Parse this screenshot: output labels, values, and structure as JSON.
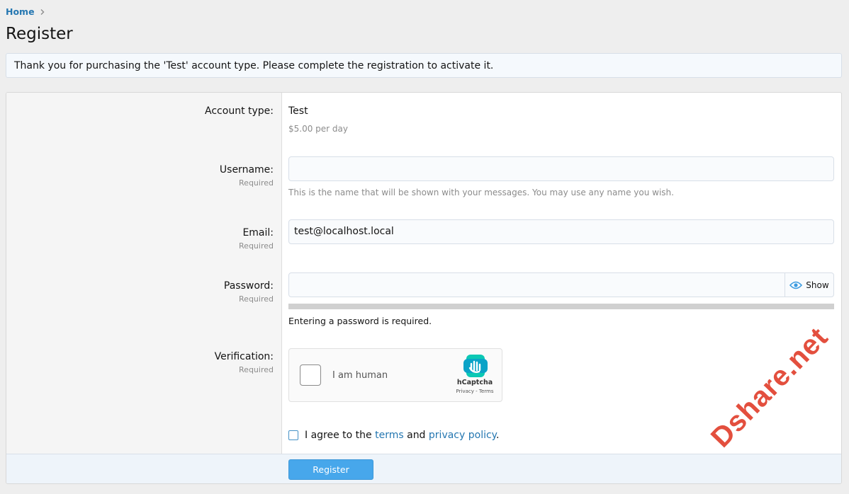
{
  "breadcrumb": {
    "home": "Home"
  },
  "page": {
    "title": "Register"
  },
  "notice": "Thank you for purchasing the 'Test' account type. Please complete the registration to activate it.",
  "form": {
    "account_type": {
      "label": "Account type:",
      "name": "Test",
      "cost": "$5.00 per day"
    },
    "username": {
      "label": "Username:",
      "required": "Required",
      "value": "",
      "hint": "This is the name that will be shown with your messages. You may use any name you wish."
    },
    "email": {
      "label": "Email:",
      "required": "Required",
      "value": "test@localhost.local"
    },
    "password": {
      "label": "Password:",
      "required": "Required",
      "value": "",
      "show_label": "Show",
      "strength_fraction": 0,
      "message": "Entering a password is required."
    },
    "verification": {
      "label": "Verification:",
      "required": "Required",
      "checkbox_text": "I am human",
      "brand": "hCaptcha",
      "links": "Privacy - Terms"
    },
    "agree": {
      "prefix": "I agree to the",
      "terms": "terms",
      "and": "and",
      "privacy": "privacy policy",
      "suffix": "."
    },
    "submit": "Register"
  },
  "watermark": "Dshare.net",
  "colors": {
    "accent": "#2577b1",
    "button": "#47a7eb",
    "watermark": "#e13d2a"
  }
}
